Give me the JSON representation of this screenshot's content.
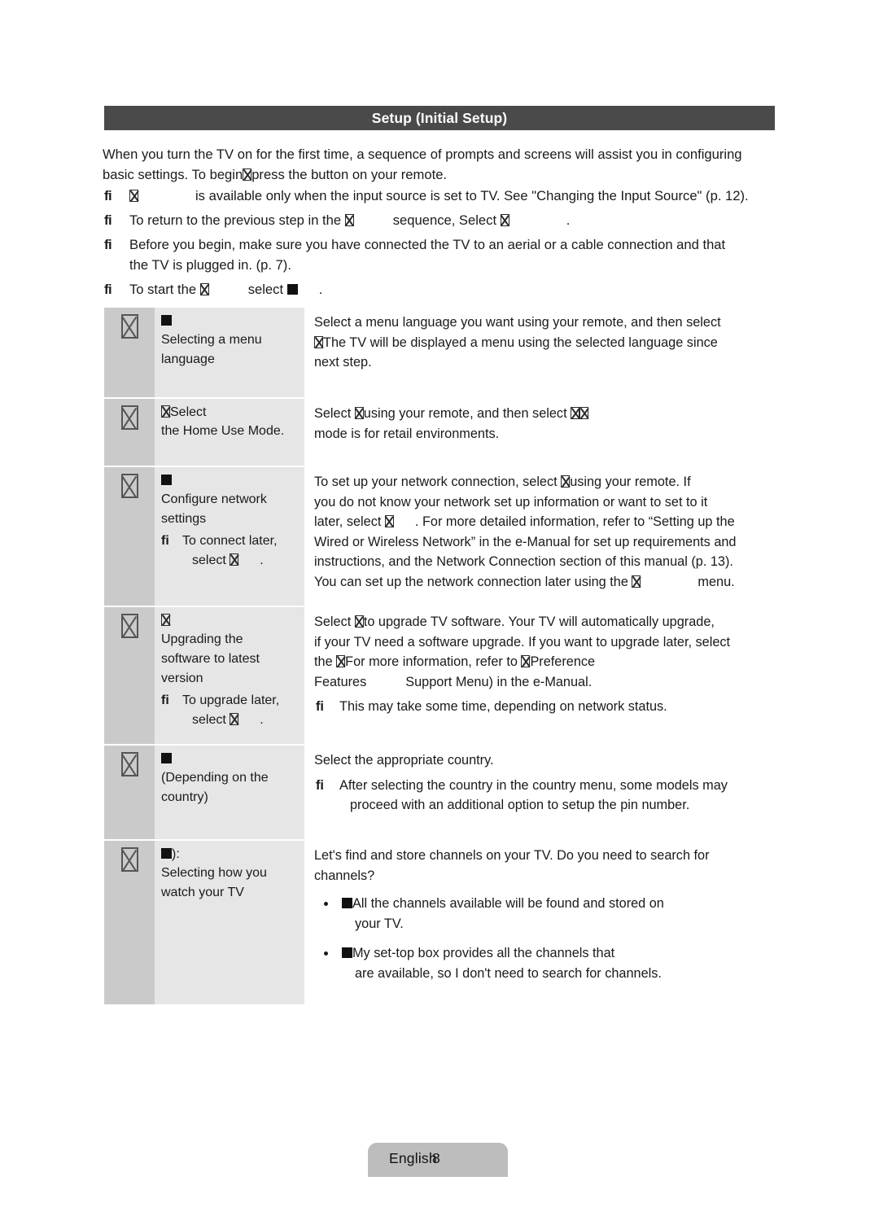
{
  "section": {
    "title": "Setup (Initial Setup)"
  },
  "intro": {
    "line1": "When you turn the TV on for the first time, a sequence of prompts and screens will assist you in configuring",
    "line2_a": "basic settings. To begin",
    "line2_b": "press the  button on your remote."
  },
  "notes": [
    {
      "mark": "fi",
      "text_a": "",
      "text_b": "is available only when the input source is set to TV. See \"Changing the Input Source\" (p. 12)."
    },
    {
      "mark": "fi",
      "text_a": "To return to the previous step in the",
      "text_b": "sequence, Select",
      "text_c": "."
    },
    {
      "mark": "fi",
      "text_a": "Before you begin, make sure you have connected the TV to an aerial or a cable connection and that",
      "text_b": "the TV is plugged in. (p. 7)."
    },
    {
      "mark": "fi",
      "text_a": "To start the",
      "text_b": "select",
      "text_c": "."
    }
  ],
  "steps": [
    {
      "name_head": "",
      "name_line1": "Selecting a menu",
      "name_line2": "language",
      "desc_line1": "Select a menu language you want using your remote, and then select",
      "desc_line2": "The TV will be displayed a menu using the selected language since",
      "desc_line3": "next step."
    },
    {
      "name_head": "Select",
      "name_line1": "the Home Use Mode.",
      "desc_line1_a": "Select",
      "desc_line1_b": "using your remote, and then select",
      "desc_line2": "mode is for retail environments."
    },
    {
      "name_head": "",
      "name_line1": "Configure network",
      "name_line2": "settings",
      "sub_mark": "fi",
      "sub_line1": "To connect later,",
      "sub_line2_a": "select",
      "sub_line2_b": ".",
      "desc_line1_a": "To set up your network connection, select",
      "desc_line1_b": "using your remote. If",
      "desc_line2": "you do not know your network set up information or want to set to it",
      "desc_line3_a": "later, select",
      "desc_line3_b": ". For more detailed information, refer to “Setting up the",
      "desc_line4": "Wired or Wireless Network” in the e-Manual for set up requirements and",
      "desc_line5": "instructions, and the Network Connection section of this manual (p. 13).",
      "desc_line6_a": "You can set up the network connection later using the",
      "desc_line6_b": "menu."
    },
    {
      "name_head": "",
      "name_line1": "Upgrading the",
      "name_line2": "software to latest",
      "name_line3": "version",
      "sub_mark": "fi",
      "sub_line1": "To upgrade later,",
      "sub_line2_a": "select",
      "sub_line2_b": ".",
      "desc_line1_a": "Select",
      "desc_line1_b": "to upgrade TV software. Your TV will automatically upgrade,",
      "desc_line2": "if your TV need a software upgrade. If you want to upgrade later, select",
      "desc_line3_a": "the",
      "desc_line3_b": "For more information, refer to",
      "desc_line3_c": "Preference",
      "desc_line4_a": "Features",
      "desc_line4_b": "Support Menu) in the e-Manual.",
      "note_mark": "fi",
      "note_text": "This may take some time, depending on network status."
    },
    {
      "name_head": "",
      "name_line1": "(Depending on the",
      "name_line2": "country)",
      "desc_line1": "Select the appropriate country.",
      "note_mark": "fi",
      "note_line1": "After selecting the country in the country menu, some models may",
      "note_line2": "proceed with an additional option to setup the pin number."
    },
    {
      "name_head": "):",
      "name_line1": "Selecting how you",
      "name_line2": "watch your TV",
      "desc_line1": "Let's find and store channels on your TV. Do you need to search for",
      "desc_line2": "channels?",
      "bullets": [
        {
          "line1": "All the channels available will be found and stored on",
          "line2": "your TV."
        },
        {
          "line1": "My set-top box provides all the channels that",
          "line2": "are available, so I don't need to search for channels."
        }
      ]
    }
  ],
  "footer": {
    "language": "English",
    "page": "8"
  },
  "colors": {
    "header_bar": "#4a4a4a",
    "col_icon_bg": "#cacaca",
    "col_name_bg": "#e6e6e6",
    "footer_tab_bg": "#bdbdbd",
    "text": "#1a1a1a"
  }
}
